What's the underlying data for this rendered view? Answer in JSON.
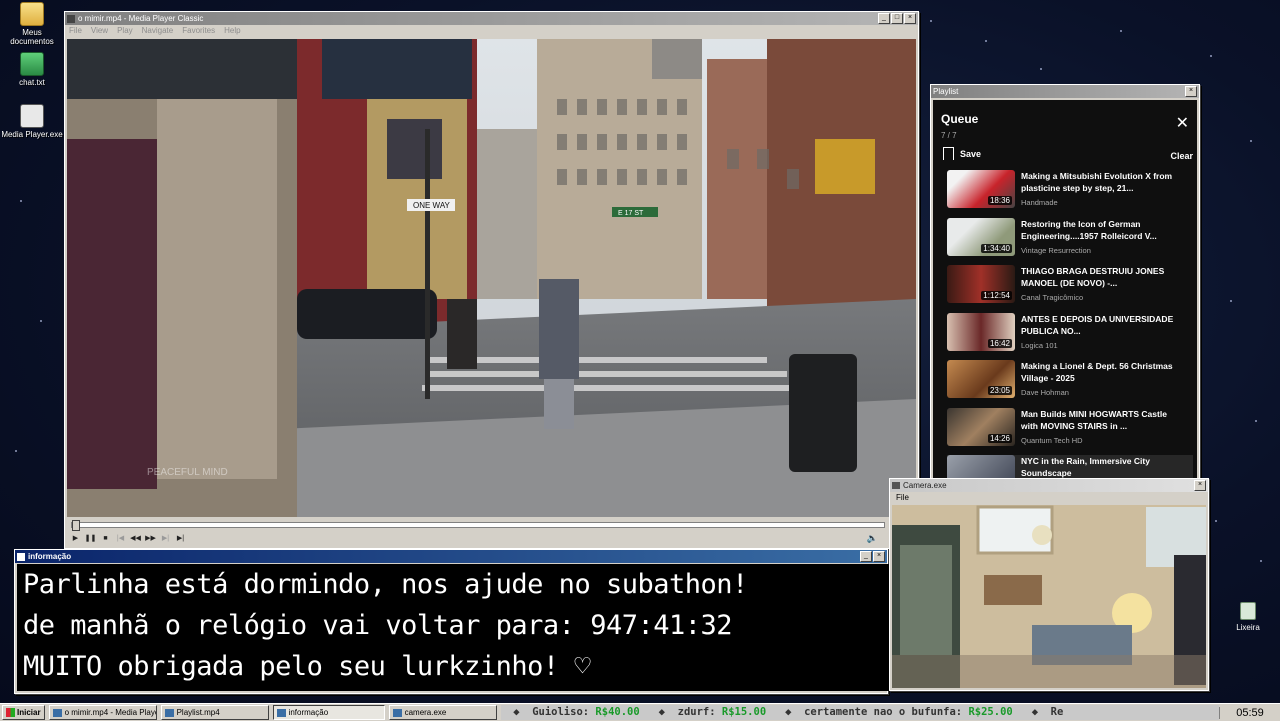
{
  "desktop": {
    "icons": [
      {
        "label": "Meus documentos",
        "icon": "folder-icon"
      },
      {
        "label": "chat.txt",
        "icon": "notepad-icon"
      },
      {
        "label": "Media Player.exe",
        "icon": "media-player-icon"
      }
    ],
    "recycle_bin": {
      "label": "Lixeira",
      "icon": "recycle-bin-icon"
    }
  },
  "media_player": {
    "title": "o mimir.mp4 - Media Player Classic",
    "menu": [
      "File",
      "View",
      "Play",
      "Navigate",
      "Favorites",
      "Help"
    ],
    "video_watermark": "PEACEFUL MIND",
    "street_signs": [
      "ONE WAY",
      "E 17 ST"
    ],
    "controls": [
      "play-icon",
      "pause-icon",
      "stop-icon",
      "skip-back-icon",
      "rewind-icon",
      "fast-forward-icon",
      "skip-forward-icon",
      "frame-step-icon"
    ],
    "seek_progress": 0.0
  },
  "playlist_window": {
    "title": "Playlist",
    "header": "Queue",
    "count": "7 / 7",
    "save_label": "Save",
    "clear_label": "Clear",
    "items": [
      {
        "title": "Making a Mitsubishi Evolution X from plasticine step by step, 21...",
        "channel": "Handmade",
        "duration": "18:36",
        "thumb_color": "#b8242a"
      },
      {
        "title": "Restoring the Icon of German Engineering....1957 Rolleicord V...",
        "channel": "Vintage Resurrection",
        "duration": "1:34:40",
        "thumb_color": "#9fa48e"
      },
      {
        "title": "THIAGO BRAGA DESTRUIU JONES MANOEL (DE NOVO) -...",
        "channel": "Canal Tragicômico",
        "duration": "1:12:54",
        "thumb_color": "#5a2a1c"
      },
      {
        "title": "ANTES E DEPOIS DA UNIVERSIDADE PUBLICA NO...",
        "channel": "Logica 101",
        "duration": "16:42",
        "thumb_color": "#7a3030"
      },
      {
        "title": "Making a Lionel & Dept. 56 Christmas Village - 2025",
        "channel": "Dave Hohman",
        "duration": "23:05",
        "thumb_color": "#8a5a38"
      },
      {
        "title": "Man Builds MINI HOGWARTS Castle with MOVING STAIRS in ...",
        "channel": "Quantum Tech HD",
        "duration": "14:26",
        "thumb_color": "#6b5b4a"
      },
      {
        "title": "NYC in the Rain, Immersive City Soundscape",
        "channel": "",
        "duration": "",
        "thumb_color": "#4a5060"
      }
    ]
  },
  "info_window": {
    "title": "informação",
    "lines": [
      "Parlinha está dormindo, nos ajude no subathon!",
      "de manhã o relógio vai voltar para:  947:41:32",
      "MUITO obrigada pelo seu lurkzinho! ♡"
    ]
  },
  "camera_window": {
    "title": "Camera.exe",
    "menu": "File"
  },
  "taskbar": {
    "start_label": "Iniciar",
    "tasks": [
      {
        "label": "o mimir.mp4 - Media Playe...",
        "active": false
      },
      {
        "label": "Playlist.mp4",
        "active": false
      },
      {
        "label": "informação",
        "active": true
      },
      {
        "label": "camera.exe",
        "active": false
      }
    ],
    "ticker": [
      {
        "name": "Guioliso:",
        "amount": "R$40.00"
      },
      {
        "name": "zdurf:",
        "amount": "R$15.00"
      },
      {
        "name": "certamente nao o bufunfa:",
        "amount": "R$25.00"
      },
      {
        "name": "Re",
        "amount": ""
      }
    ],
    "clock": "05:59"
  }
}
